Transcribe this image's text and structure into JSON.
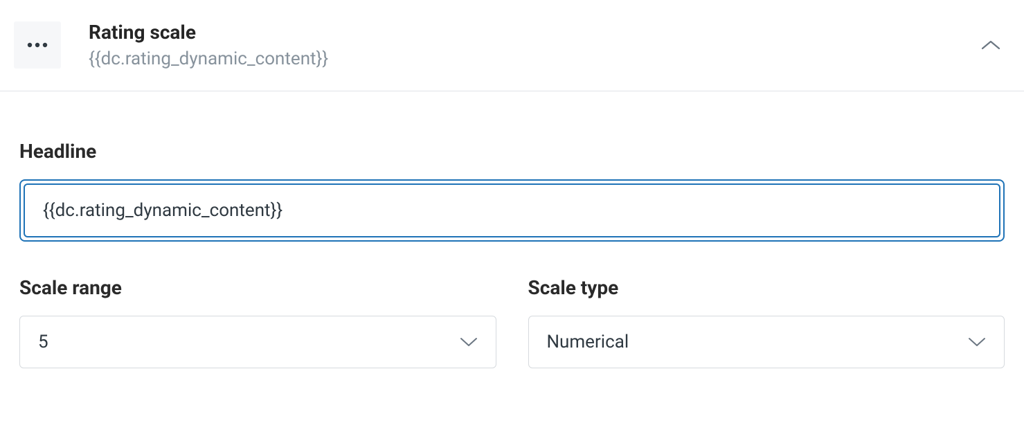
{
  "header": {
    "title": "Rating scale",
    "subtitle": "{{dc.rating_dynamic_content}}"
  },
  "fields": {
    "headline": {
      "label": "Headline",
      "value": "{{dc.rating_dynamic_content}}"
    },
    "scale_range": {
      "label": "Scale range",
      "value": "5"
    },
    "scale_type": {
      "label": "Scale type",
      "value": "Numerical"
    }
  }
}
